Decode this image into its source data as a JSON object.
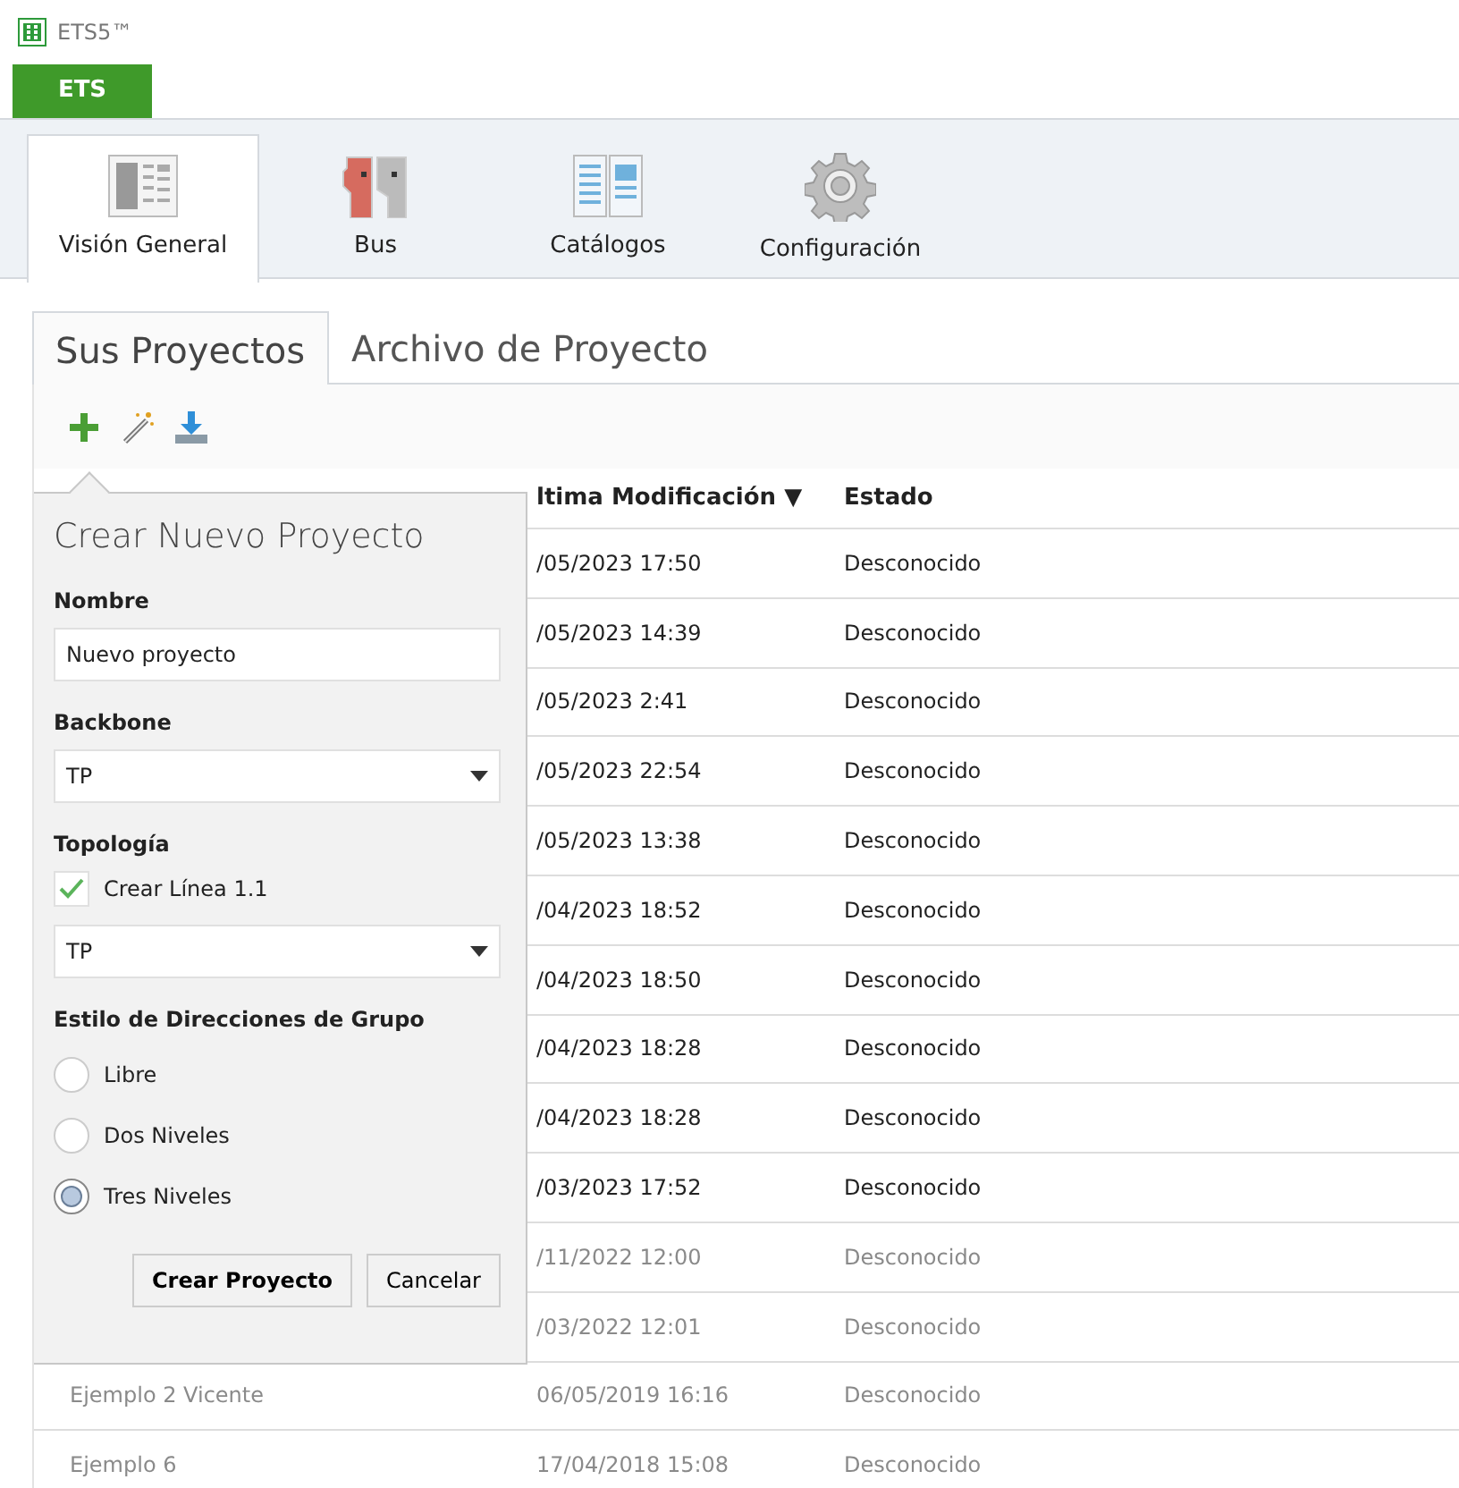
{
  "window": {
    "title": "ETS5™"
  },
  "app_tab": {
    "label": "ETS"
  },
  "ribbon_tabs": [
    {
      "label": "Visión General",
      "selected": true
    },
    {
      "label": "Bus",
      "selected": false
    },
    {
      "label": "Catálogos",
      "selected": false
    },
    {
      "label": "Configuración",
      "selected": false
    }
  ],
  "sub_tabs": [
    {
      "label": "Sus Proyectos",
      "selected": true
    },
    {
      "label": "Archivo de Proyecto",
      "selected": false
    }
  ],
  "table": {
    "columns": [
      {
        "label": "ltima Modificación",
        "sort": "▼"
      },
      {
        "label": "Estado"
      }
    ],
    "rows": [
      {
        "modified": "/05/2023 17:50",
        "status": "Desconocido",
        "greyed": false
      },
      {
        "modified": "/05/2023 14:39",
        "status": "Desconocido",
        "greyed": false
      },
      {
        "modified": "/05/2023 2:41",
        "status": "Desconocido",
        "greyed": false
      },
      {
        "modified": "/05/2023 22:54",
        "status": "Desconocido",
        "greyed": false
      },
      {
        "modified": "/05/2023 13:38",
        "status": "Desconocido",
        "greyed": false
      },
      {
        "modified": "/04/2023 18:52",
        "status": "Desconocido",
        "greyed": false
      },
      {
        "modified": "/04/2023 18:50",
        "status": "Desconocido",
        "greyed": false
      },
      {
        "modified": "/04/2023 18:28",
        "status": "Desconocido",
        "greyed": false
      },
      {
        "modified": "/04/2023 18:28",
        "status": "Desconocido",
        "greyed": false
      },
      {
        "modified": "/03/2023 17:52",
        "status": "Desconocido",
        "greyed": false
      },
      {
        "modified": "/11/2022 12:00",
        "status": "Desconocido",
        "greyed": true
      },
      {
        "modified": "/03/2022 12:01",
        "status": "Desconocido",
        "greyed": true
      },
      {
        "name": "Ejemplo 2 Vicente",
        "modified": "06/05/2019 16:16",
        "status": "Desconocido",
        "greyed": true
      },
      {
        "name": "Ejemplo 6",
        "modified": "17/04/2018 15:08",
        "status": "Desconocido",
        "greyed": true
      }
    ]
  },
  "new_project": {
    "title": "Crear Nuevo Proyecto",
    "name_label": "Nombre",
    "name_value": "Nuevo proyecto",
    "backbone_label": "Backbone",
    "backbone_value": "TP",
    "topology_label": "Topología",
    "create_line": {
      "label": "Crear Línea 1.1",
      "checked": true
    },
    "topology_value": "TP",
    "group_style_label": "Estilo de Direcciones de Grupo",
    "group_styles": [
      {
        "label": "Libre",
        "selected": false
      },
      {
        "label": "Dos Niveles",
        "selected": false
      },
      {
        "label": "Tres Niveles",
        "selected": true
      }
    ],
    "buttons": [
      {
        "label": "Crear Proyecto",
        "kind": "primary"
      },
      {
        "label": "Cancelar",
        "kind": "secondary"
      }
    ]
  }
}
